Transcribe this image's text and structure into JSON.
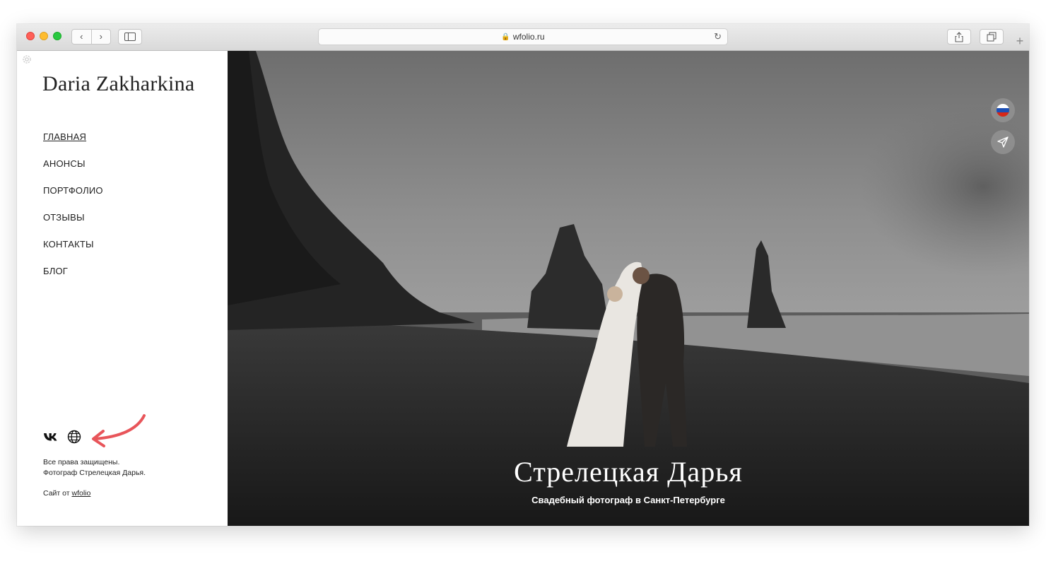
{
  "browser": {
    "url": "wfolio.ru",
    "back_glyph": "‹",
    "forward_glyph": "›",
    "reload_glyph": "↻",
    "lock_glyph": "🔒",
    "new_tab_glyph": "+"
  },
  "sidebar": {
    "site_name": "Daria Zakharkina",
    "nav": [
      {
        "label": "ГЛАВНАЯ",
        "active": true
      },
      {
        "label": "АНОНСЫ"
      },
      {
        "label": "ПОРТФОЛИО"
      },
      {
        "label": "ОТЗЫВЫ"
      },
      {
        "label": "КОНТАКТЫ"
      },
      {
        "label": "БЛОГ"
      }
    ],
    "social": {
      "vk_label": "vk",
      "globe_icon": "globe-icon"
    },
    "copyright_line1": "Все права защищены.",
    "copyright_line2": "Фотограф Стрелецкая Дарья.",
    "credit_prefix": "Сайт от",
    "credit_link": "wfolio"
  },
  "hero": {
    "title": "Стрелецкая Дарья",
    "subtitle": "Свадебный фотограф в Санкт-Петербурге"
  },
  "colors": {
    "annotation_arrow": "#e8555a",
    "flag_white": "#ffffff",
    "flag_blue": "#1c4fb5",
    "flag_red": "#d62718"
  }
}
